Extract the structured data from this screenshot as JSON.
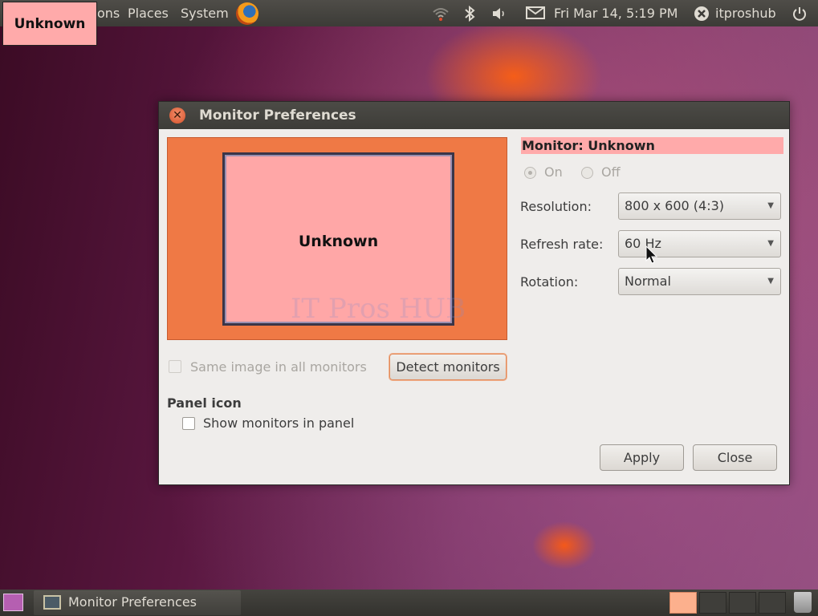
{
  "top_panel": {
    "menus": [
      "ons",
      "Places",
      "System"
    ],
    "datetime": "Fri Mar 14,  5:19 PM",
    "username": "itproshub",
    "icons": [
      "firefox-icon",
      "wifi-icon",
      "bluetooth-icon",
      "volume-icon",
      "mail-icon",
      "user-status-icon",
      "power-icon"
    ]
  },
  "overlay_label": "Unknown",
  "dialog": {
    "title": "Monitor Preferences",
    "preview_monitor_label": "Unknown",
    "watermark": "IT Pros HUB",
    "monitor_header": "Monitor: Unknown",
    "power": {
      "on_label": "On",
      "off_label": "Off",
      "selected": "On"
    },
    "resolution": {
      "label": "Resolution:",
      "value": "800 x 600 (4:3)"
    },
    "refresh_rate": {
      "label": "Refresh rate:",
      "value": "60 Hz"
    },
    "rotation": {
      "label": "Rotation:",
      "value": "Normal"
    },
    "same_image_label": "Same image in all monitors",
    "detect_button": "Detect monitors",
    "panel_icon_title": "Panel icon",
    "show_monitors_label": "Show monitors in panel",
    "apply_button": "Apply",
    "close_button": "Close"
  },
  "bottom_panel": {
    "task_label": "Monitor Preferences",
    "workspace_count": 4,
    "active_workspace": 1
  },
  "colors": {
    "monitor_highlight": "#ffaaaa",
    "preview_background": "#ef7945",
    "active_workspace": "#fcb08d"
  }
}
